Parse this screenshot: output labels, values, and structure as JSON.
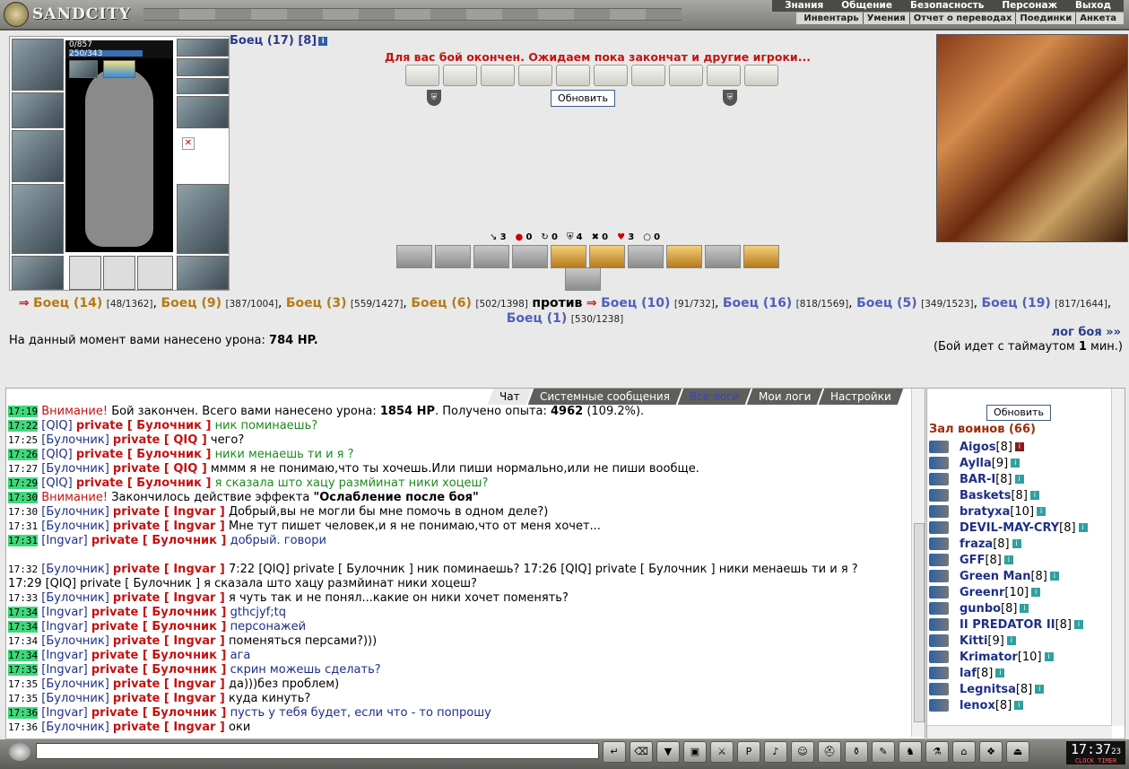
{
  "app": {
    "logo_text": "SANDCITY"
  },
  "menu_top": [
    "Знания",
    "Общение",
    "Безопасность",
    "Персонаж",
    "Выход"
  ],
  "menu_sub": [
    "Инвентарь",
    "Умения",
    "Отчет о переводах",
    "Поединки",
    "Анкета"
  ],
  "character": {
    "name": "Боец (17) [8]",
    "mana": "0/857",
    "hp": "250/343",
    "hp_fraction": 0.73
  },
  "battle": {
    "status": "Для вас бой окончен. Ожидаем пока закончат и другие игроки...",
    "refresh_label": "Обновить",
    "stats": [
      "3",
      "0",
      "0",
      "4",
      "0",
      "3",
      "0"
    ],
    "team1": [
      {
        "name": "Боец (14)",
        "hp": "[48/1362]"
      },
      {
        "name": "Боец (9)",
        "hp": "[387/1004]"
      },
      {
        "name": "Боец (3)",
        "hp": "[559/1427]"
      },
      {
        "name": "Боец (6)",
        "hp": "[502/1398]"
      }
    ],
    "vs": "против",
    "team2": [
      {
        "name": "Боец (10)",
        "hp": "[91/732]"
      },
      {
        "name": "Боец (16)",
        "hp": "[818/1569]"
      },
      {
        "name": "Боец (5)",
        "hp": "[349/1523]"
      },
      {
        "name": "Боец (19)",
        "hp": "[817/1644]"
      },
      {
        "name": "Боец (1)",
        "hp": "[530/1238]"
      }
    ],
    "damage_label": "На данный момент вами нанесено урона:",
    "damage_value": "784 HP.",
    "log_link": "лог боя »»",
    "timeout_pre": "(Бой идет с таймаутом",
    "timeout_val": "1",
    "timeout_post": "мин.)"
  },
  "chat": {
    "tabs": [
      "Чат",
      "Системные сообщения",
      "Все логи",
      "Мои логи",
      "Настройки"
    ],
    "lines": [
      {
        "t": "17:19",
        "hl": true,
        "parts": [
          [
            "warn",
            "Внимание! "
          ],
          [
            "",
            "Бой закончен. Всего вами нанесено урона: "
          ],
          [
            "b",
            "1854 HP"
          ],
          [
            "",
            ". Получено опыта: "
          ],
          [
            "b",
            "4962"
          ],
          [
            "",
            " (109.2%)."
          ]
        ]
      },
      {
        "t": "17:22",
        "hl": true,
        "parts": [
          [
            "who",
            "[QIQ] "
          ],
          [
            "priv",
            "private [ Булочник ]"
          ],
          [
            "msg-green",
            " ник поминаешь?"
          ]
        ]
      },
      {
        "t": "17:25",
        "hl": false,
        "parts": [
          [
            "who",
            "[Булочник] "
          ],
          [
            "priv",
            "private [ QIQ ]"
          ],
          [
            "",
            " чего?"
          ]
        ]
      },
      {
        "t": "17:26",
        "hl": true,
        "parts": [
          [
            "who",
            "[QIQ] "
          ],
          [
            "priv",
            "private [ Булочник ]"
          ],
          [
            "msg-green",
            " ники менаешь ти и я ?"
          ]
        ]
      },
      {
        "t": "17:27",
        "hl": false,
        "parts": [
          [
            "who",
            "[Булочник] "
          ],
          [
            "priv",
            "private [ QIQ ]"
          ],
          [
            "",
            " мммм я не понимаю,что ты хочешь.Или пиши нормально,или не пиши вообще."
          ]
        ]
      },
      {
        "t": "17:29",
        "hl": true,
        "parts": [
          [
            "who",
            "[QIQ] "
          ],
          [
            "priv",
            "private [ Булочник ]"
          ],
          [
            "msg-green",
            " я сказала што хацу размйинат ники хоцеш?"
          ]
        ]
      },
      {
        "t": "17:30",
        "hl": true,
        "parts": [
          [
            "warn",
            "Внимание! "
          ],
          [
            "",
            " Закончилось действие эффекта "
          ],
          [
            "b",
            "\"Ослабление после боя\""
          ]
        ]
      },
      {
        "t": "17:30",
        "hl": false,
        "parts": [
          [
            "who",
            "[Булочник] "
          ],
          [
            "priv",
            "private [ Ingvar ]"
          ],
          [
            "",
            " Добрый,вы не могли бы мне помочь в одном деле?)"
          ]
        ]
      },
      {
        "t": "17:31",
        "hl": false,
        "parts": [
          [
            "who",
            "[Булочник] "
          ],
          [
            "priv",
            "private [ Ingvar ]"
          ],
          [
            "",
            " Мне тут пишет человек,и я не понимаю,что от меня хочет..."
          ]
        ]
      },
      {
        "t": "17:31",
        "hl": true,
        "parts": [
          [
            "who",
            "[Ingvar] "
          ],
          [
            "priv",
            "private [ Булочник ]"
          ],
          [
            "msg-blue",
            " добрый. говори"
          ]
        ]
      },
      {
        "t": "",
        "hl": false,
        "parts": [
          [
            "",
            ""
          ]
        ]
      },
      {
        "t": "17:32",
        "hl": false,
        "parts": [
          [
            "who",
            "[Булочник] "
          ],
          [
            "priv",
            "private [ Ingvar ]"
          ],
          [
            "",
            " 7:22 [QIQ] private [ Булочник ] ник поминаешь? 17:26 [QIQ] private [ Булочник ] ники менаешь ти и я ?"
          ]
        ]
      },
      {
        "t": "",
        "hl": false,
        "parts": [
          [
            "",
            "17:29 [QIQ] private [ Булочник ] я сказала што хацу размйинат ники хоцеш?"
          ]
        ]
      },
      {
        "t": "17:33",
        "hl": false,
        "parts": [
          [
            "who",
            "[Булочник] "
          ],
          [
            "priv",
            "private [ Ingvar ]"
          ],
          [
            "",
            " я чуть так и не понял...какие он ники хочет поменять?"
          ]
        ]
      },
      {
        "t": "17:34",
        "hl": true,
        "parts": [
          [
            "who",
            "[Ingvar] "
          ],
          [
            "priv",
            "private [ Булочник ]"
          ],
          [
            "msg-blue",
            " gthcjyf;tq"
          ]
        ]
      },
      {
        "t": "17:34",
        "hl": true,
        "parts": [
          [
            "who",
            "[Ingvar] "
          ],
          [
            "priv",
            "private [ Булочник ]"
          ],
          [
            "msg-blue",
            " персонажей"
          ]
        ]
      },
      {
        "t": "17:34",
        "hl": false,
        "parts": [
          [
            "who",
            "[Булочник] "
          ],
          [
            "priv",
            "private [ Ingvar ]"
          ],
          [
            "",
            " поменяться персами?)))"
          ]
        ]
      },
      {
        "t": "17:34",
        "hl": true,
        "parts": [
          [
            "who",
            "[Ingvar] "
          ],
          [
            "priv",
            "private [ Булочник ]"
          ],
          [
            "msg-blue",
            " ага"
          ]
        ]
      },
      {
        "t": "17:35",
        "hl": true,
        "parts": [
          [
            "who",
            "[Ingvar] "
          ],
          [
            "priv",
            "private [ Булочник ]"
          ],
          [
            "msg-blue",
            " скрин можешь сделать?"
          ]
        ]
      },
      {
        "t": "17:35",
        "hl": false,
        "parts": [
          [
            "who",
            "[Булочник] "
          ],
          [
            "priv",
            "private [ Ingvar ]"
          ],
          [
            "",
            " да)))без проблем)"
          ]
        ]
      },
      {
        "t": "17:35",
        "hl": false,
        "parts": [
          [
            "who",
            "[Булочник] "
          ],
          [
            "priv",
            "private [ Ingvar ]"
          ],
          [
            "",
            " куда кинуть?"
          ]
        ]
      },
      {
        "t": "17:36",
        "hl": true,
        "parts": [
          [
            "who",
            "[Ingvar] "
          ],
          [
            "priv",
            "private [ Булочник ]"
          ],
          [
            "msg-blue",
            " пусть у тебя будет, если что - то попрошу"
          ]
        ]
      },
      {
        "t": "17:36",
        "hl": false,
        "parts": [
          [
            "who",
            "[Булочник] "
          ],
          [
            "priv",
            "private [ Ingvar ]"
          ],
          [
            "",
            " оки"
          ]
        ]
      }
    ]
  },
  "people": {
    "refresh_label": "Обновить",
    "hall_title": "Зал воинов (66)",
    "list": [
      {
        "name": "Aigos",
        "lvl": "[8]",
        "red": true
      },
      {
        "name": "Aylla",
        "lvl": "[9]",
        "red": false
      },
      {
        "name": "BAR-I",
        "lvl": "[8]",
        "red": false
      },
      {
        "name": "Baskets",
        "lvl": "[8]",
        "red": false
      },
      {
        "name": "bratyxa",
        "lvl": "[10]",
        "red": false
      },
      {
        "name": "DEVIL-MAY-CRY",
        "lvl": "[8]",
        "red": false
      },
      {
        "name": "fraza",
        "lvl": "[8]",
        "red": false
      },
      {
        "name": "GFF",
        "lvl": "[8]",
        "red": false
      },
      {
        "name": "Green Man",
        "lvl": "[8]",
        "red": false
      },
      {
        "name": "Greenr",
        "lvl": "[10]",
        "red": false
      },
      {
        "name": "gunbo",
        "lvl": "[8]",
        "red": false
      },
      {
        "name": "II PREDATOR II",
        "lvl": "[8]",
        "red": false
      },
      {
        "name": "Kitti",
        "lvl": "[9]",
        "red": false
      },
      {
        "name": "Krimator",
        "lvl": "[10]",
        "red": false
      },
      {
        "name": "laf",
        "lvl": "[8]",
        "red": false
      },
      {
        "name": "Legnitsa",
        "lvl": "[8]",
        "red": false
      },
      {
        "name": "lenox",
        "lvl": "[8]",
        "red": false
      }
    ]
  },
  "clock": {
    "time": "17:37",
    "sec": "23",
    "label": "CLOCK TIMER"
  }
}
